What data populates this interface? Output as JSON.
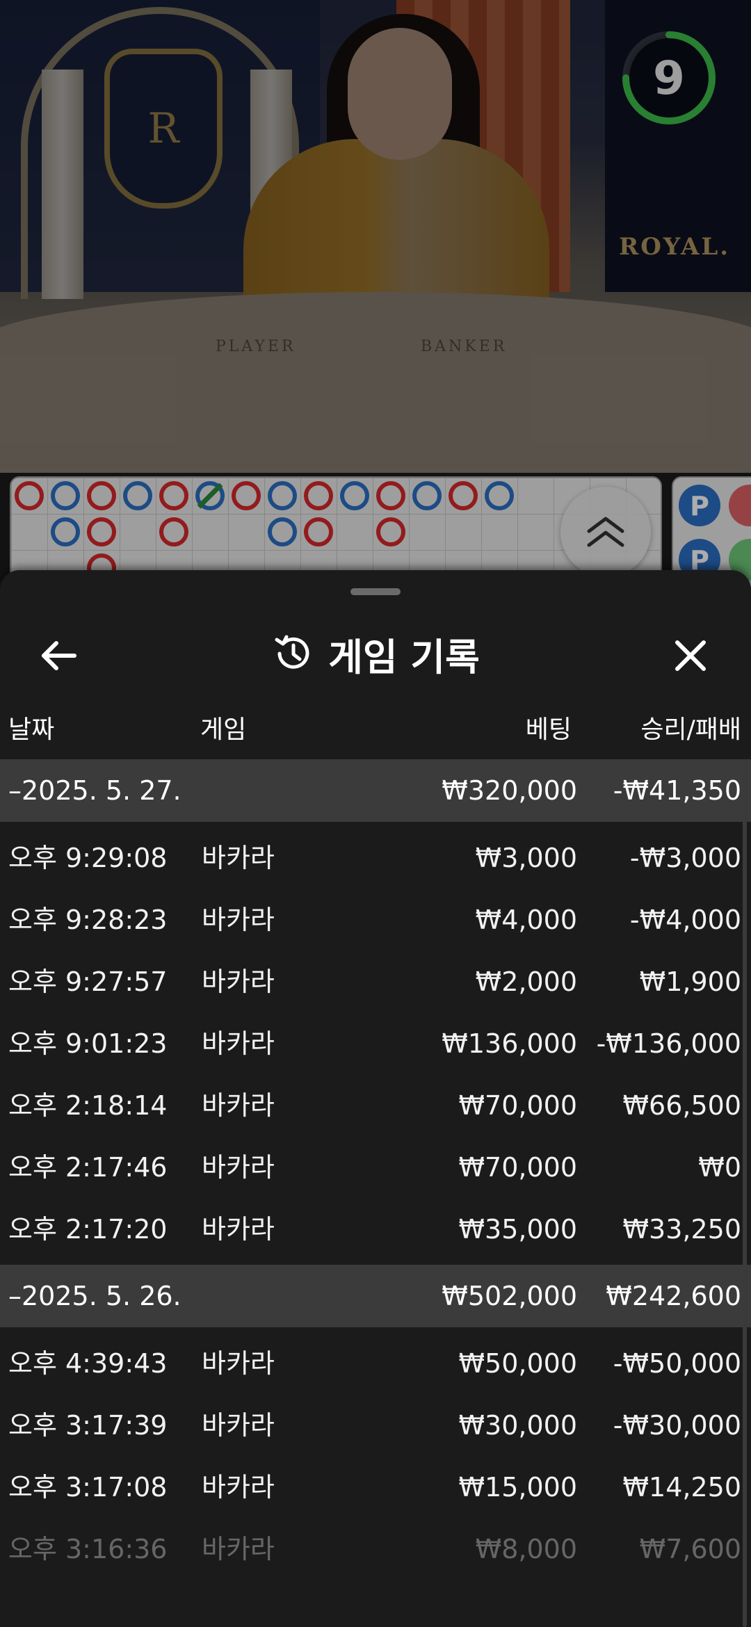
{
  "video": {
    "countdown": "9",
    "countdown_fraction": 0.75,
    "brand_sign": "ROYAL.",
    "crest_letter": "R",
    "table_labels": [
      "PLAYER",
      "BANKER"
    ]
  },
  "roadmap": {
    "colors": {
      "banker": "#d8282c",
      "player": "#2b6fc4",
      "tie": "#2c8a3a"
    },
    "big_road_columns": [
      [
        "banker"
      ],
      [
        "player",
        "player"
      ],
      [
        "banker",
        "banker",
        "banker"
      ],
      [
        "player"
      ],
      [
        "banker",
        "banker"
      ],
      [
        "player"
      ],
      [
        "banker"
      ],
      [
        "player",
        "player"
      ],
      [
        "banker",
        "banker"
      ],
      [
        "player"
      ],
      [
        "banker",
        "banker"
      ],
      [
        "player"
      ],
      [
        "banker"
      ],
      [
        "player"
      ]
    ],
    "side_labels": [
      "P",
      "P"
    ]
  },
  "sheet": {
    "title": "게임 기록",
    "columns": {
      "date": "날짜",
      "game": "게임",
      "bet": "베팅",
      "winloss": "승리/패배"
    },
    "groups": [
      {
        "date": "–2025. 5. 27.",
        "bet": "₩320,000",
        "winloss": "-₩41,350",
        "rows": [
          {
            "time": "오후 9:29:08",
            "game": "바카라",
            "bet": "₩3,000",
            "winloss": "-₩3,000"
          },
          {
            "time": "오후 9:28:23",
            "game": "바카라",
            "bet": "₩4,000",
            "winloss": "-₩4,000"
          },
          {
            "time": "오후 9:27:57",
            "game": "바카라",
            "bet": "₩2,000",
            "winloss": "₩1,900"
          },
          {
            "time": "오후 9:01:23",
            "game": "바카라",
            "bet": "₩136,000",
            "winloss": "-₩136,000"
          },
          {
            "time": "오후 2:18:14",
            "game": "바카라",
            "bet": "₩70,000",
            "winloss": "₩66,500"
          },
          {
            "time": "오후 2:17:46",
            "game": "바카라",
            "bet": "₩70,000",
            "winloss": "₩0"
          },
          {
            "time": "오후 2:17:20",
            "game": "바카라",
            "bet": "₩35,000",
            "winloss": "₩33,250"
          }
        ]
      },
      {
        "date": "–2025. 5. 26.",
        "bet": "₩502,000",
        "winloss": "₩242,600",
        "rows": [
          {
            "time": "오후 4:39:43",
            "game": "바카라",
            "bet": "₩50,000",
            "winloss": "-₩50,000"
          },
          {
            "time": "오후 3:17:39",
            "game": "바카라",
            "bet": "₩30,000",
            "winloss": "-₩30,000"
          },
          {
            "time": "오후 3:17:08",
            "game": "바카라",
            "bet": "₩15,000",
            "winloss": "₩14,250"
          },
          {
            "time": "오후 3:16:36",
            "game": "바카라",
            "bet": "₩8,000",
            "winloss": "₩7,600"
          }
        ]
      }
    ]
  }
}
